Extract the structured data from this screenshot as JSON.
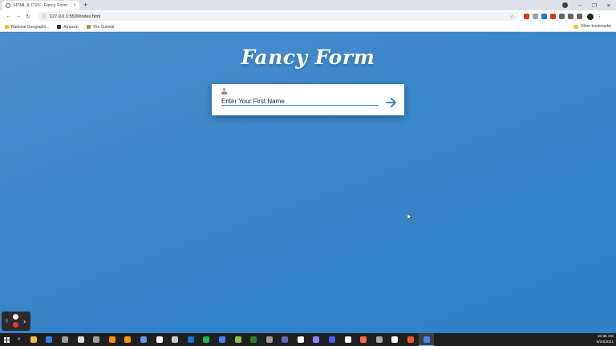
{
  "browser": {
    "tab": {
      "title": "HTML & CSS - Fancy Form",
      "close_glyph": "×"
    },
    "new_tab_glyph": "+",
    "window_controls": {
      "minimize": "–",
      "maximize": "❐",
      "close": "✕"
    },
    "toolbar": {
      "back": "←",
      "forward": "→",
      "reload": "↻",
      "url": "127.0.0.1:5500/index.html",
      "star": "☆",
      "menu": "⋮"
    },
    "extensions": [
      "#d93025",
      "#9aa0a6",
      "#1a73e8",
      "#d93025",
      "#5f6368",
      "#5f6368",
      "#5f6368"
    ],
    "bookmarks": [
      {
        "label": "National Geographi...",
        "icon": "natgeo-icon",
        "color": "#f5c518"
      },
      {
        "label": "Amazon",
        "icon": "amazon-icon",
        "color": "#232f3e"
      },
      {
        "label": "The Summit",
        "icon": "summit-icon",
        "color": "#7cb342"
      }
    ],
    "other_bookmarks": "Other bookmarks"
  },
  "page": {
    "title": "Fancy Form",
    "form": {
      "placeholder": "Enter Your First Name",
      "value": ""
    },
    "colors": {
      "background": "#3a86c8",
      "accent": "#3a86c8",
      "card": "#ffffff"
    }
  },
  "recorder": {
    "pause": "pause-icon",
    "stop": "stop-icon"
  },
  "taskbar": {
    "apps": [
      "#f0c14b",
      "#2b88d8",
      "#9e9e9e",
      "#e0e0e0",
      "#9e9e9e",
      "#ff8f00",
      "#ff9800",
      "#6495ed",
      "#ffffff",
      "#cccccc",
      "#0078d7",
      "#1db954",
      "#4285f4",
      "#8bc34a",
      "#2e7d32",
      "#9e9e9e",
      "#5c6bc0",
      "#ffffff",
      "#8a8aff",
      "#4a5cff",
      "#ffffff",
      "#ff7043",
      "#aaaaaa",
      "#ffffff",
      "#fb542b",
      "#4285f4"
    ],
    "time": "10:35 AM",
    "date": "6/24/2021"
  }
}
